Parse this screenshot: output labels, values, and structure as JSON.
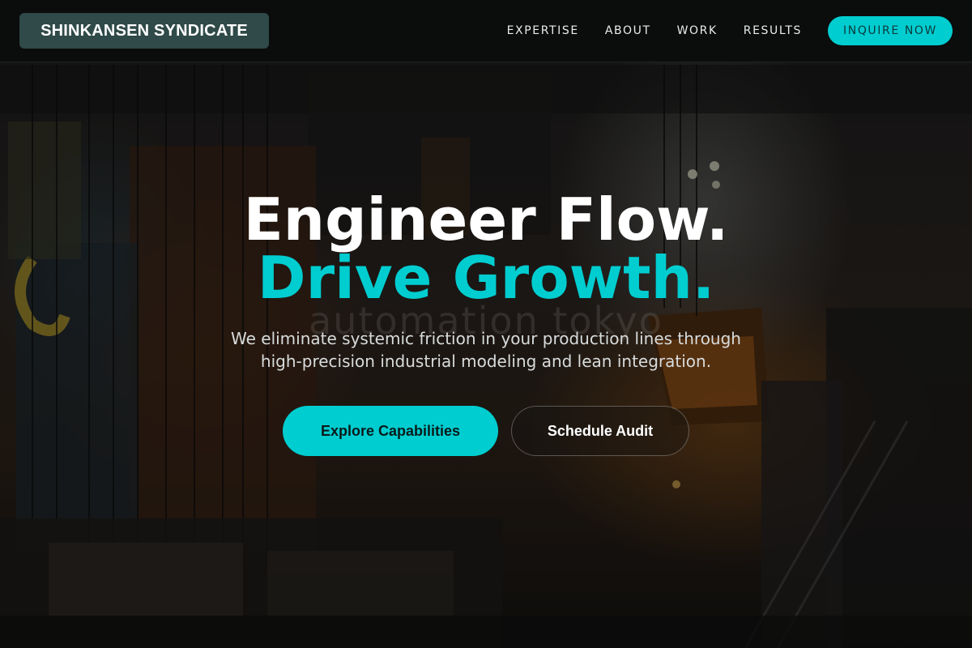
{
  "header": {
    "logo": "SHINKANSEN SYNDICATE",
    "nav": [
      {
        "label": "EXPERTISE"
      },
      {
        "label": "ABOUT"
      },
      {
        "label": "WORK"
      },
      {
        "label": "RESULTS"
      }
    ],
    "cta_label": "INQUIRE NOW"
  },
  "hero": {
    "headline_line1": "Engineer Flow.",
    "headline_line2": "Drive Growth.",
    "watermark": "automation tokyo",
    "subtitle": "We eliminate systemic friction in your production lines through high-precision industrial modeling and lean integration.",
    "primary_button": "Explore Capabilities",
    "secondary_button": "Schedule Audit"
  },
  "colors": {
    "accent": "#00cdd0",
    "header_bg": "#0b0c0c",
    "logo_bg": "#2f4a48"
  }
}
